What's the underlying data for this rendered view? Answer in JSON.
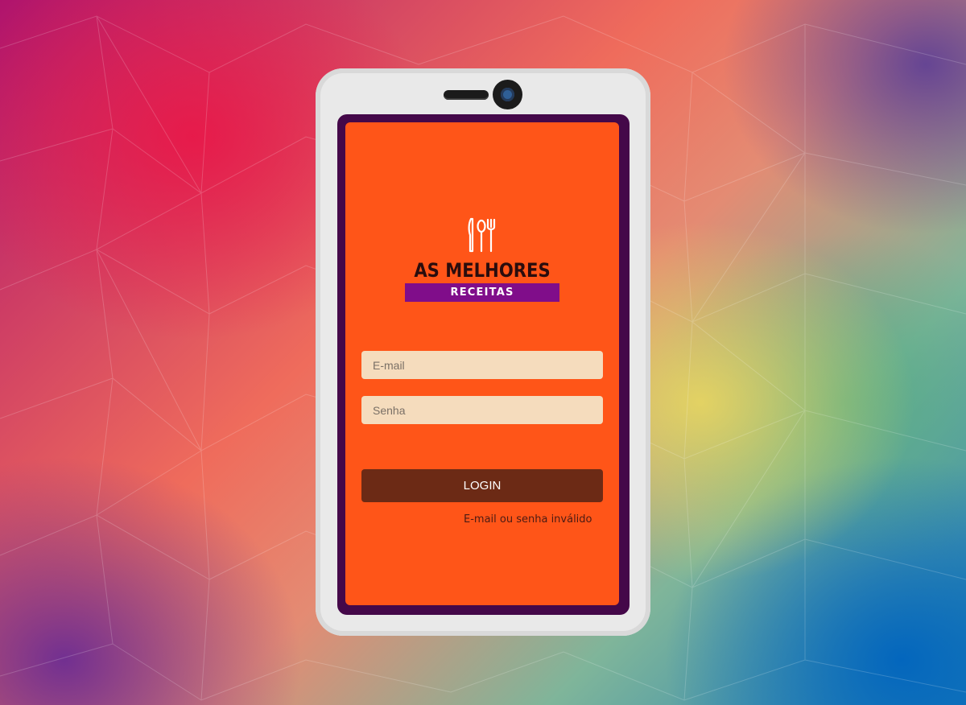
{
  "brand": {
    "title": "AS MELHORES",
    "subtitle": "RECEITAS",
    "icon": "utensils-icon"
  },
  "form": {
    "email_placeholder": "E-mail",
    "email_value": "",
    "password_placeholder": "Senha",
    "password_value": "",
    "login_label": "LOGIN",
    "error_message": "E-mail ou senha inválido"
  },
  "colors": {
    "screen_background": "#ff5518",
    "screen_frame": "#440849",
    "field_background": "#f5dcbd",
    "login_button": "#6c2a15",
    "brand_band": "#800d8a",
    "phone_body": "#e9e9e9"
  }
}
